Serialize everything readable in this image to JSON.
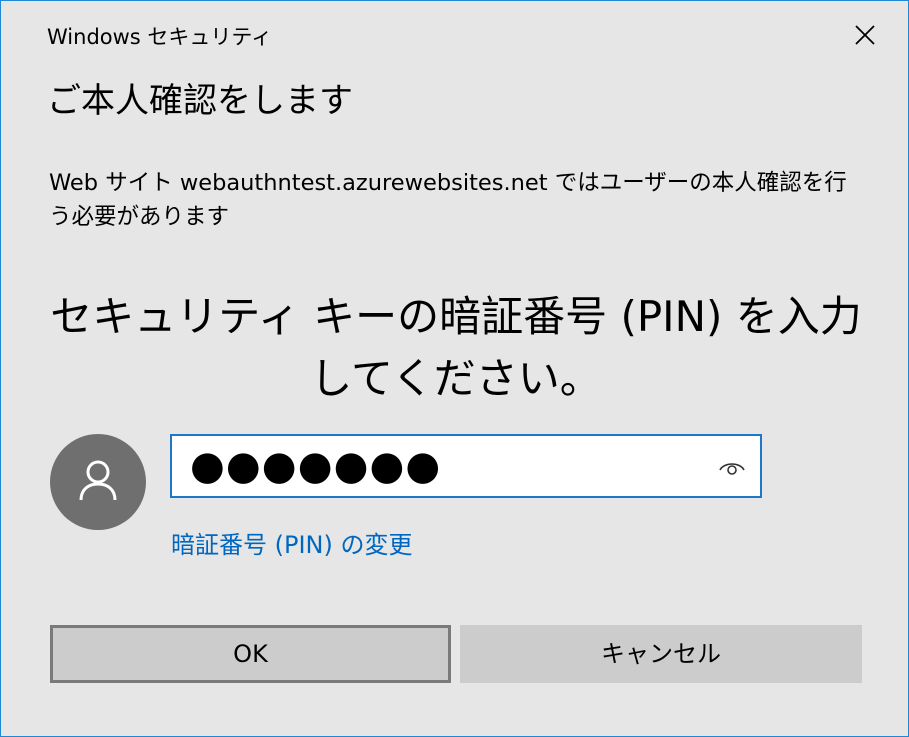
{
  "window": {
    "title": "Windows セキュリティ"
  },
  "dialog": {
    "heading": "ご本人確認をします",
    "description": "Web サイト webauthntest.azurewebsites.net ではユーザーの本人確認を行う必要があります",
    "prompt": "セキュリティ キーの暗証番号 (PIN) を入力してください。",
    "pin_field": {
      "masked_value": "●●●●●●●",
      "reveal_icon": "eye-icon"
    },
    "change_pin_link": "暗証番号 (PIN) の変更",
    "avatar_icon": "user-icon"
  },
  "buttons": {
    "ok_label": "OK",
    "cancel_label": "キャンセル"
  },
  "colors": {
    "background": "#e6e6e6",
    "accent": "#1e78c8",
    "link": "#0067c0",
    "button": "#cccccc",
    "avatar": "#6f6f6f"
  }
}
